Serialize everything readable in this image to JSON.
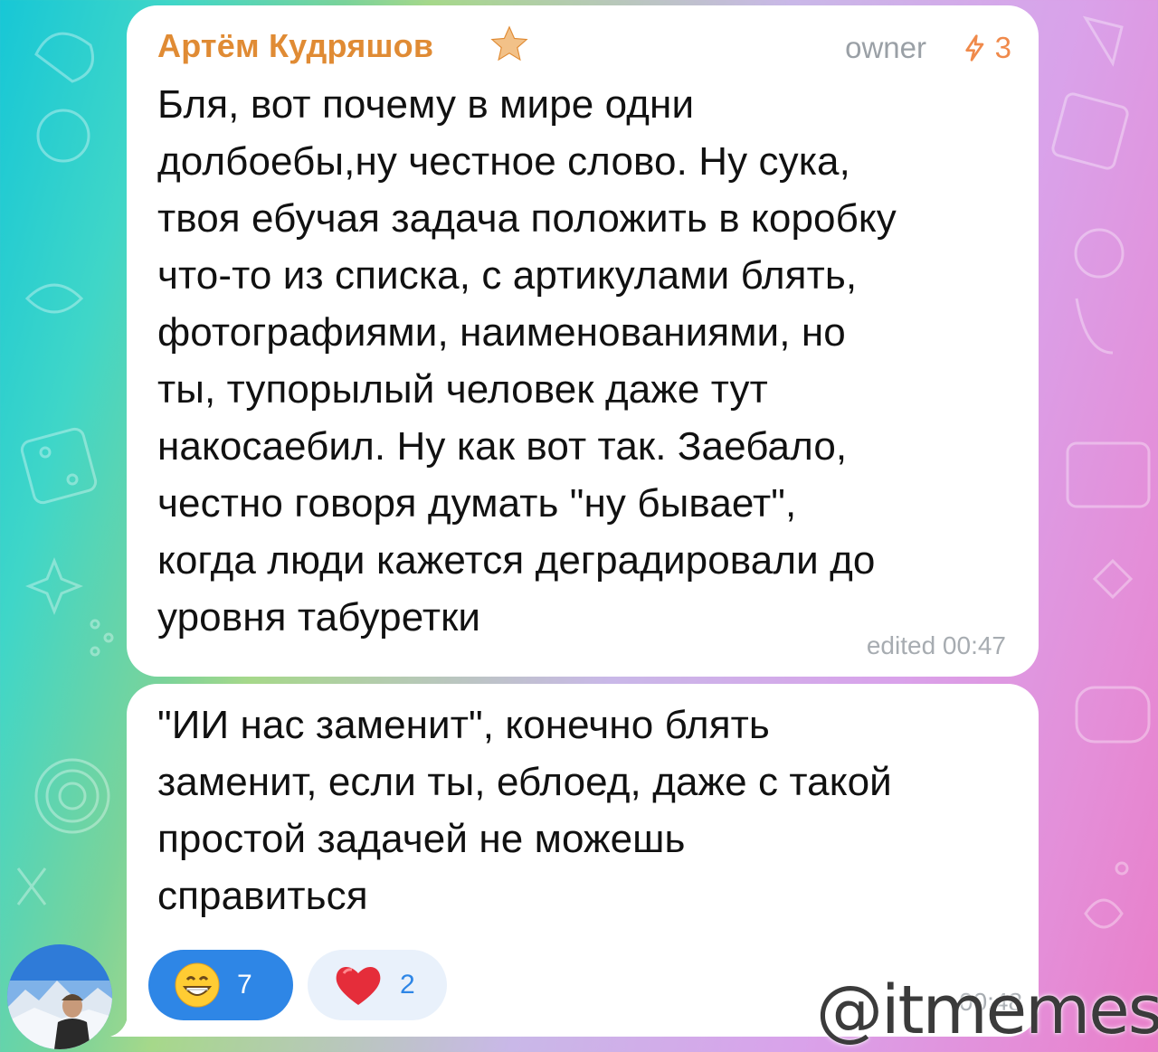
{
  "message1": {
    "sender": "Артём Кудряшов",
    "role": "owner",
    "boost_count": "3",
    "text": "Бля, вот почему в мире одни\nдолбоебы,ну честное слово. Ну сука,\nтвоя ебучая задача положить в коробку\nчто-то из списка, с артикулами блять,\nфотографиями, наименованиями, но\nты, тупорылый человек даже тут\nнакосаебил. Ну как вот так. Заебало,\nчестно говоря думать \"ну бывает\",\nкогда люди кажется деградировали до\nуровня табуретки",
    "meta": "edited 00:47"
  },
  "message2": {
    "text": "\"ИИ нас заменит\", конечно блять\nзаменит, если ты, еблоед, даже с такой\nпростой задачей не можешь\nсправиться",
    "time": "00:48",
    "reactions": [
      {
        "emoji": "grinning-face",
        "count": "7",
        "selected": true
      },
      {
        "emoji": "red-heart",
        "count": "2",
        "selected": false
      }
    ]
  },
  "watermark": "@itmemes",
  "colors": {
    "sender": "#e08b34",
    "accent": "#2e86e6",
    "heart": "#e52d3a"
  }
}
